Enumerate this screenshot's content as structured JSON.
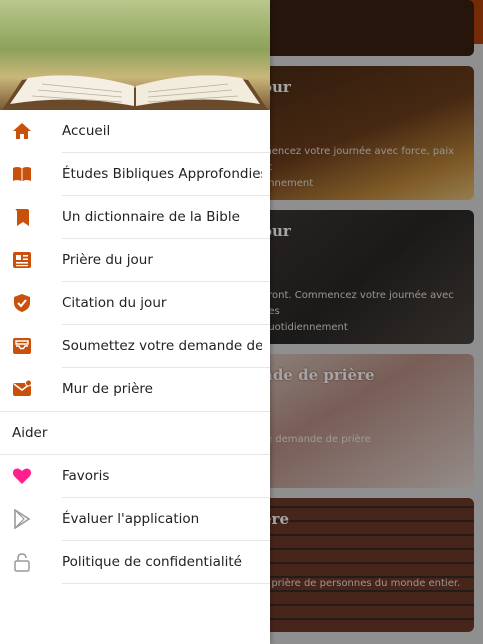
{
  "colors": {
    "accent": "#b3410c",
    "icon": "#c9510c",
    "heart": "#ff1f8f"
  },
  "drawer": {
    "items": [
      {
        "label": "Accueil",
        "icon": "home-icon"
      },
      {
        "label": "Études Bibliques Approfondies",
        "icon": "book-open-icon"
      },
      {
        "label": "Un dictionnaire de la Bible",
        "icon": "bookmark-icon"
      },
      {
        "label": "Prière du jour",
        "icon": "newspaper-icon"
      },
      {
        "label": "Citation du jour",
        "icon": "shield-check-icon"
      },
      {
        "label": "Soumettez votre demande de ...",
        "icon": "inbox-icon"
      },
      {
        "label": "Mur de prière",
        "icon": "mail-icon"
      }
    ],
    "section_label": "Aider",
    "help_items": [
      {
        "label": "Favoris",
        "icon": "heart-icon"
      },
      {
        "label": "Évaluer l'application",
        "icon": "play-store-icon"
      },
      {
        "label": "Politique de confidentialité",
        "icon": "lock-icon"
      }
    ]
  },
  "cards": [
    {
      "title": "",
      "desc": ""
    },
    {
      "title": "our",
      "desc": "mencez votre journée avec force, paix et\nennement"
    },
    {
      "title": "our",
      "desc": "eront. Commencez votre journée avec des\n quotidiennement"
    },
    {
      "title": "nde de prière",
      "desc": "re demande de prière"
    },
    {
      "title": "ère",
      "desc": "e prière de personnes du monde entier."
    }
  ]
}
